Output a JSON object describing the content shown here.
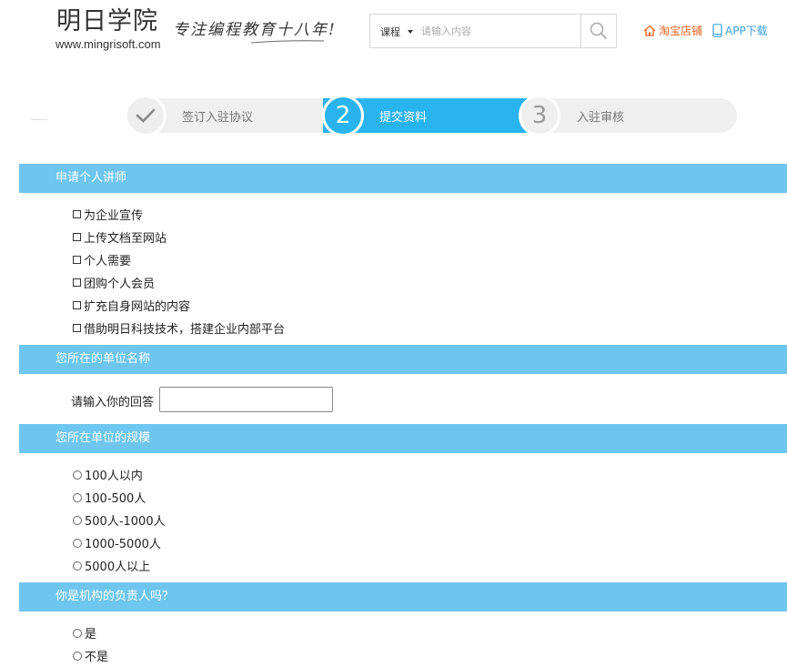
{
  "header": {
    "logo_title": "明日学院",
    "logo_url": "www.mingrisoft.com",
    "slogan": "专注编程教育十八年!",
    "search": {
      "category": "课程",
      "placeholder": "请输入内容"
    },
    "shop_link": "淘宝店铺",
    "app_link": "APP下载",
    "icons": {
      "search": "search-icon",
      "shop": "home-icon",
      "app": "phone-icon",
      "caret": "caret-down-icon"
    },
    "colors": {
      "shop": "#e8601c",
      "app": "#3aa0e0"
    }
  },
  "steps": {
    "items": [
      {
        "number": "✓",
        "label": "签订入驻协议",
        "state": "done"
      },
      {
        "number": "2",
        "label": "提交资料",
        "state": "active"
      },
      {
        "number": "3",
        "label": "入驻审核",
        "state": "pending"
      }
    ],
    "colors": {
      "active": "#29b4f0",
      "inactive": "#efefef"
    }
  },
  "sections": {
    "purpose": {
      "title": "申请个人讲师",
      "options": [
        "为企业宣传",
        "上传文档至网站",
        "个人需要",
        "团购个人会员",
        "扩充自身网站的内容",
        "借助明日科技技术，搭建企业内部平台"
      ]
    },
    "company": {
      "title": "您所在的单位名称",
      "label": "请输入你的回答",
      "value": ""
    },
    "scale": {
      "title": "您所在单位的规模",
      "options": [
        "100人以内",
        "100-500人",
        "500人-1000人",
        "1000-5000人",
        "5000人以上"
      ]
    },
    "leader": {
      "title": "你是机构的负责人吗？",
      "options": [
        "是",
        "不是"
      ]
    },
    "colors": {
      "header_bg": "#6ec5ee"
    }
  }
}
